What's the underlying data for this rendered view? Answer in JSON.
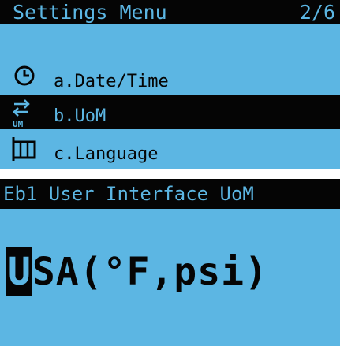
{
  "settings_menu": {
    "title": "Settings Menu",
    "page": "2/6",
    "items": [
      {
        "label": "a.Date/Time",
        "icon": "clock-icon",
        "selected": false
      },
      {
        "label": "b.UoM",
        "icon": "units-swap-icon",
        "icon_text": "UM",
        "selected": true
      },
      {
        "label": "c.Language",
        "icon": "language-book-icon",
        "selected": false
      }
    ]
  },
  "uom_screen": {
    "header": "Eb1 User Interface UoM",
    "value_cursor_char": "U",
    "value_rest": "SA(°F,psi)"
  },
  "colors": {
    "lcd_background": "#5cb6e3",
    "lcd_foreground": "#050505"
  }
}
